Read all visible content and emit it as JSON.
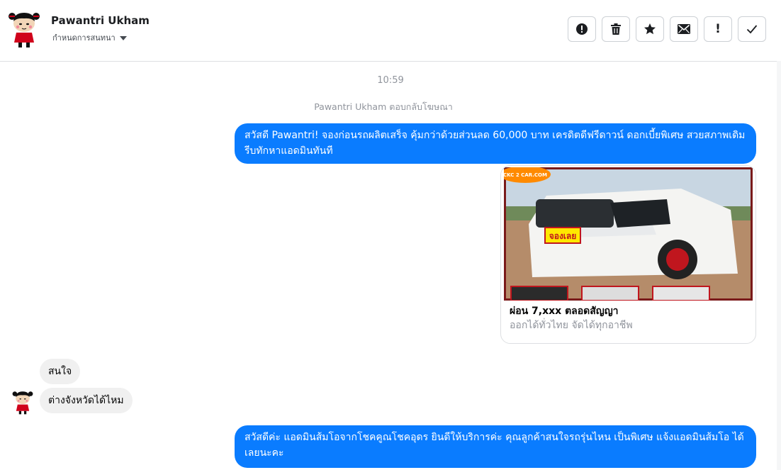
{
  "header": {
    "contact_name": "Pawantri Ukham",
    "assign_label": "กำหนดการสนทนา",
    "actions": [
      {
        "name": "spam-button",
        "icon": "alert-circle-icon"
      },
      {
        "name": "delete-button",
        "icon": "trash-icon"
      },
      {
        "name": "star-button",
        "icon": "star-icon"
      },
      {
        "name": "mark-unread-button",
        "icon": "envelope-icon"
      },
      {
        "name": "important-button",
        "icon": "exclamation-icon",
        "glyph": "!"
      },
      {
        "name": "done-button",
        "icon": "checkmark-icon"
      }
    ]
  },
  "conversation": {
    "timestamp": "10:59",
    "system_note": "Pawantri Ukham ตอบกลับโฆษณา",
    "messages": [
      {
        "direction": "outgoing",
        "text": "สวัสดี Pawantri! จองก่อนรถผลิตเสร็จ คุ้มกว่าด้วยส่วนลด 60,000 บาท เครดิตดีฟรีดาวน์ ดอกเบี้ยพิเศษ สวยสภาพเดิม รีบทักหาแอดมินทันที"
      },
      {
        "direction": "outgoing",
        "type": "card",
        "image_badge": "จองเลย",
        "image_logo": "CKC 2 CAR.COM",
        "title": "ผ่อน 7,xxx ตลอดสัญญา",
        "subtitle": "ออกได้ทั่วไทย จัดได้ทุกอาชีพ"
      },
      {
        "direction": "incoming",
        "text": "สนใจ"
      },
      {
        "direction": "incoming",
        "text": "ต่างจังหวัดได้ไหม"
      },
      {
        "direction": "outgoing",
        "text": "สวัสดีค่ะ แอดมินส้มโอจากโชคคูณโชคอุดร ยินดีให้บริการค่ะ   คุณลูกค้าสนใจรถรุ่นไหน เป็นพิเศษ แจ้งแอดมินส้มโอ ได้เลยนะคะ"
      }
    ]
  },
  "colors": {
    "outgoing_bubble": "#0a7cff",
    "incoming_bubble": "#f0f0f0",
    "meta_text": "#90949c",
    "border": "#dddfe2"
  }
}
